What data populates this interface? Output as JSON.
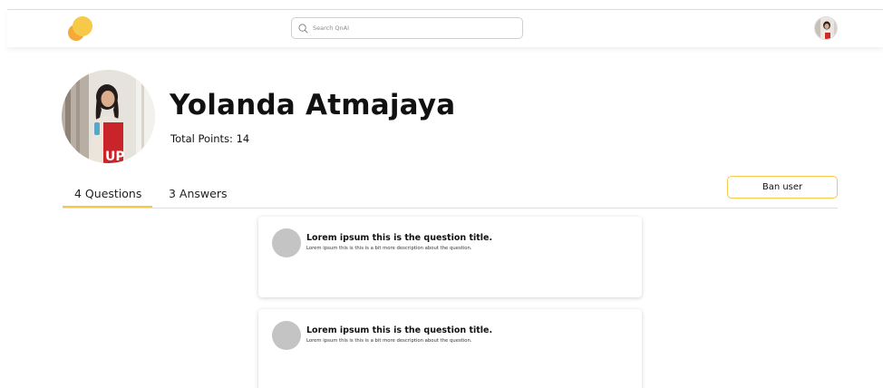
{
  "header": {
    "search_placeholder": "Search QnAI",
    "logo_icon": "chat-bubbles-icon",
    "accent_color": "#f7c948"
  },
  "profile": {
    "name": "Yolanda Atmajaya",
    "points_label": "Total Points: 14"
  },
  "tabs": [
    {
      "label": "4 Questions",
      "active": true
    },
    {
      "label": "3 Answers",
      "active": false
    }
  ],
  "actions": {
    "ban_label": "Ban user"
  },
  "questions": [
    {
      "title": "Lorem ipsum this is the question title.",
      "description": "Lorem ipsum this is this is a bit more description about the question."
    },
    {
      "title": "Lorem ipsum this is the question title.",
      "description": "Lorem ipsum this is this is a bit more description about the question."
    }
  ]
}
